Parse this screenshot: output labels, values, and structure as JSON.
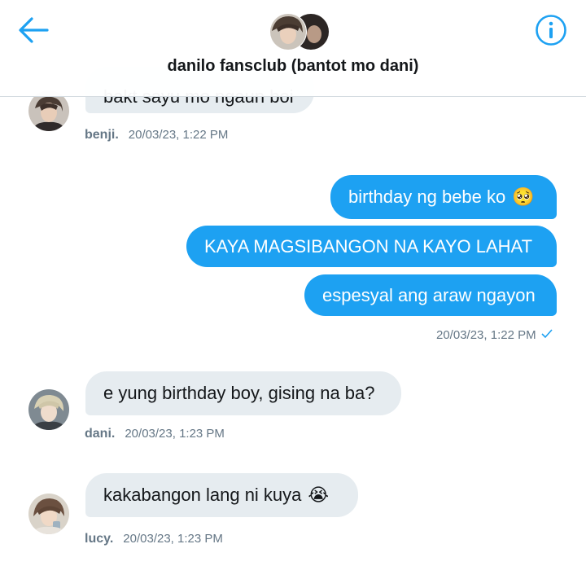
{
  "header": {
    "title": "danilo fansclub (bantot mo dani)",
    "back_icon": "back-arrow-icon",
    "info_icon": "info-icon",
    "accent_color": "#1da1f2"
  },
  "messages": [
    {
      "direction": "in",
      "text": "bakt sayu mo ngaun boi",
      "sender": "benji.",
      "timestamp": "20/03/23, 1:22 PM",
      "truncated": true
    },
    {
      "direction": "out",
      "text": "birthday ng bebe ko",
      "emoji": "🥺"
    },
    {
      "direction": "out",
      "text": "KAYA MAGSIBANGON NA KAYO LAHAT"
    },
    {
      "direction": "out",
      "text": "espesyal ang araw ngayon",
      "timestamp": "20/03/23, 1:22 PM",
      "status_icon": "check-icon"
    },
    {
      "direction": "in",
      "text": "e yung birthday boy, gising na ba?",
      "sender": "dani.",
      "timestamp": "20/03/23, 1:23 PM"
    },
    {
      "direction": "in",
      "text": "kakabangon lang ni kuya",
      "emoji": "😭",
      "sender": "lucy.",
      "timestamp": "20/03/23, 1:23 PM"
    }
  ],
  "colors": {
    "outgoing_bubble": "#1da1f2",
    "incoming_bubble": "#e6ecf0",
    "meta_text": "#657786"
  }
}
